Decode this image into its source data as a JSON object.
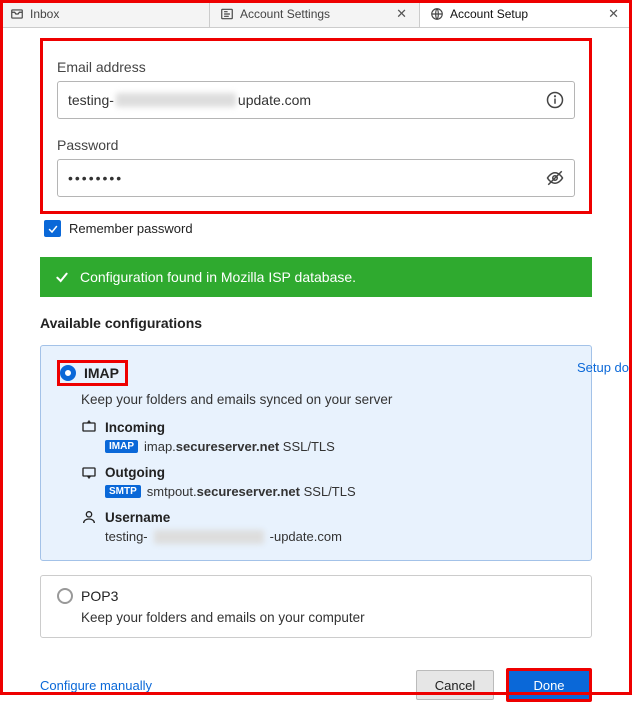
{
  "tabs": {
    "inbox": "Inbox",
    "settings": "Account Settings",
    "setup": "Account Setup"
  },
  "form": {
    "email_label": "Email address",
    "email_prefix": "testing-",
    "email_suffix": "update.com",
    "password_label": "Password",
    "password_value": "••••••••",
    "remember_label": "Remember password"
  },
  "banner": {
    "text": "Configuration found in Mozilla ISP database."
  },
  "configs": {
    "title": "Available configurations",
    "imap": {
      "name": "IMAP",
      "desc": "Keep your folders and emails synced on your server",
      "incoming_title": "Incoming",
      "incoming_badge": "IMAP",
      "incoming_prefix": "imap.",
      "incoming_host": "secureserver.net",
      "incoming_enc": " SSL/TLS",
      "outgoing_title": "Outgoing",
      "outgoing_badge": "SMTP",
      "outgoing_prefix": "smtpout.",
      "outgoing_host": "secureserver.net",
      "outgoing_enc": " SSL/TLS",
      "username_title": "Username",
      "username_prefix": "testing-",
      "username_suffix": "-update.com"
    },
    "pop": {
      "name": "POP3",
      "desc": "Keep your folders and emails on your computer"
    }
  },
  "footer": {
    "configure": "Configure manually",
    "cancel": "Cancel",
    "done": "Done"
  },
  "side": {
    "setup_doc": "Setup do"
  }
}
